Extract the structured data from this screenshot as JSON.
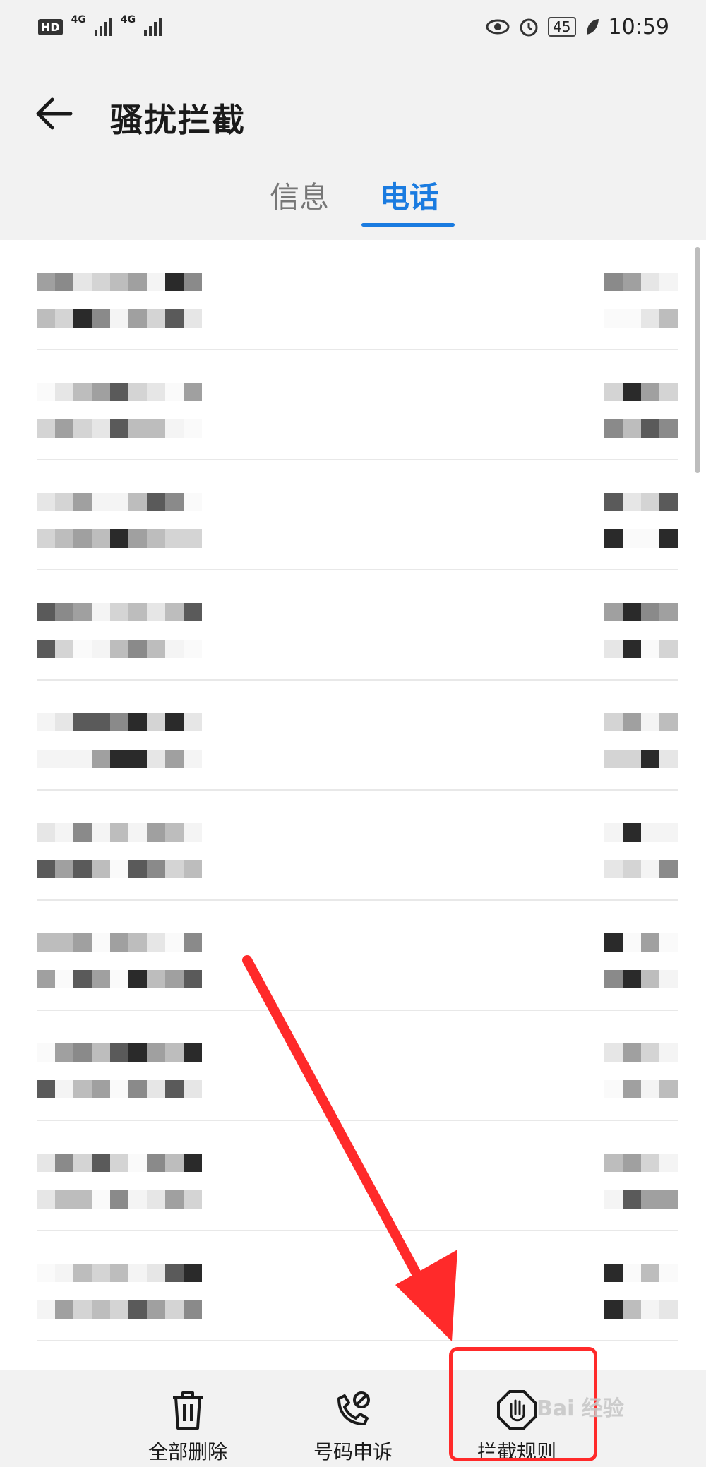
{
  "status_bar": {
    "hd": "HD",
    "net1": "4G",
    "net2": "4G",
    "battery": "45",
    "time": "10:59"
  },
  "header": {
    "title": "骚扰拦截"
  },
  "tabs": [
    {
      "label": "信息"
    },
    {
      "label": "电话"
    }
  ],
  "bottom_actions": {
    "delete_all": "全部删除",
    "number_appeal": "号码申诉",
    "block_rules": "拦截规则"
  },
  "watermark": "Bai 经验",
  "colors": {
    "accent": "#1a7be0",
    "highlight": "#ff2a2a",
    "background": "#f2f2f2"
  }
}
